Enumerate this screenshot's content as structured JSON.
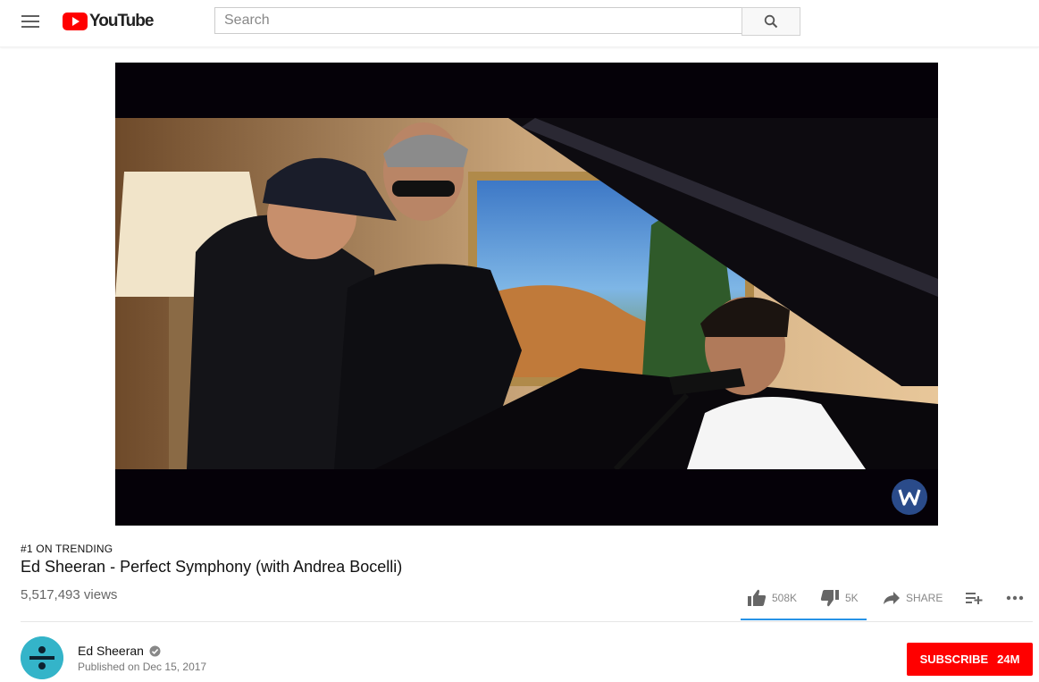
{
  "header": {
    "logo_text": "YouTube",
    "search_placeholder": "Search"
  },
  "video": {
    "badge": "#1 ON TRENDING",
    "title": "Ed Sheeran - Perfect Symphony (with Andrea Bocelli)",
    "views": "5,517,493 views",
    "like_count": "508K",
    "dislike_count": "5K",
    "share_label": "SHARE",
    "like_ratio": 0.99
  },
  "channel": {
    "name": "Ed Sheeran",
    "published": "Published on Dec 15, 2017",
    "subscribe_label": "SUBSCRIBE",
    "subscriber_count": "24M"
  },
  "colors": {
    "brand_red": "#ff0000",
    "sentiment_blue": "#2793e6"
  },
  "icons": [
    "menu-icon",
    "youtube-logo",
    "search-icon",
    "thumbs-up-icon",
    "thumbs-down-icon",
    "share-icon",
    "add-to-playlist-icon",
    "more-icon",
    "verified-icon",
    "warner-logo"
  ]
}
